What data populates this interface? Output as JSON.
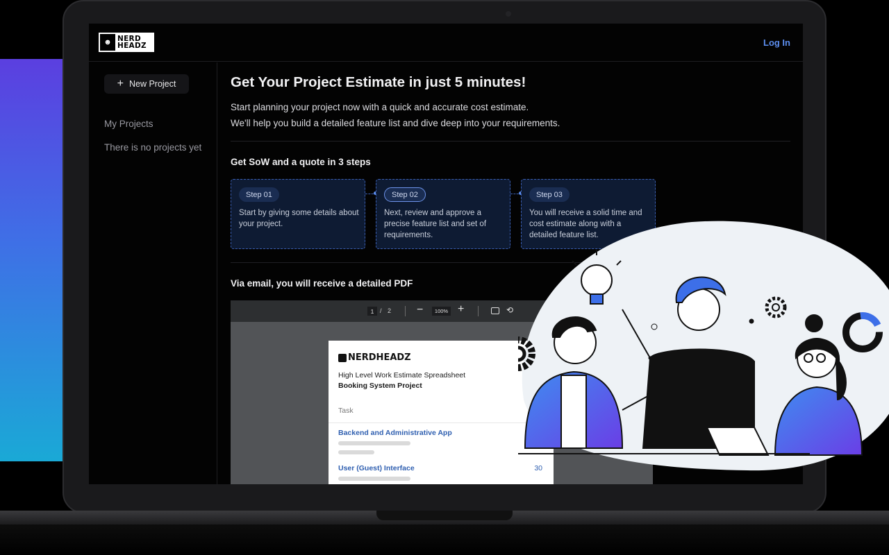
{
  "brand": {
    "logo_text_1": "NERD",
    "logo_text_2": "HEADZ",
    "logo_icon": "nerd-face-icon"
  },
  "header": {
    "login_label": "Log In"
  },
  "sidebar": {
    "new_project_label": "New Project",
    "new_project_icon": "plus-icon",
    "section_title": "My Projects",
    "empty_text": "There is no projects yet"
  },
  "main": {
    "title": "Get Your Project Estimate in just 5 minutes!",
    "intro_line_1": "Start planning your project now with a quick and accurate cost estimate.",
    "intro_line_2": "We'll help you build a detailed feature list and dive deep into your requirements.",
    "steps_title": "Get SoW and a quote in 3 steps",
    "steps": [
      {
        "badge": "Step 01",
        "text": "Start by giving some details about your project."
      },
      {
        "badge": "Step 02",
        "text": "Next, review and approve a precise feature list and set of requirements."
      },
      {
        "badge": "Step 03",
        "text": "You will receive a solid time and cost estimate along with a detailed feature list."
      }
    ],
    "pdf_title": "Via email, you will receive a detailed PDF"
  },
  "pdf_viewer": {
    "current_page": "1",
    "separator": "/",
    "total_pages": "2",
    "zoom": "100%"
  },
  "pdf_document": {
    "logo_text": "NERDHEADZ",
    "line_1": "High Level Work Estimate Spreadsheet",
    "line_2": "Booking System Project",
    "column_task": "Task",
    "items": [
      {
        "label": "Backend and Administrative App",
        "value": ""
      },
      {
        "label": "User (Guest) Interface",
        "value": "30"
      }
    ]
  },
  "colors": {
    "accent": "#5d8ff0",
    "step_card_bg": "#0e1b33",
    "step_border": "#3b5fb4",
    "gradient_top": "#5b3fe0",
    "gradient_bottom": "#1aa9d6"
  }
}
